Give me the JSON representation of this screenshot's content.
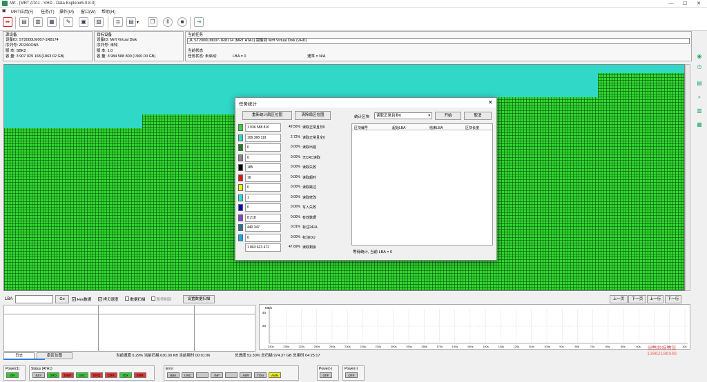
{
  "window": {
    "title": "Mrt - [MRT ATA1 - VHD - Data Explorer6.0.8.3]"
  },
  "menu": [
    "MRT应用(F)",
    "任务(T)",
    "操作(M)",
    "窗口(W)",
    "帮助(H)"
  ],
  "source": {
    "label": "源设备",
    "id": "设备ID: ST2000LM007-1R8174",
    "serial": "序列号: ZDZ60ON5",
    "version": "版    本: SBK2",
    "capacity": "容    量: 3 907 029 168 (1863.02 GB)"
  },
  "target": {
    "label": "目标设备",
    "id": "设备ID: Mrft Virtual Disk",
    "serial": "序列号: 未知",
    "version": "版    本: 1.0",
    "capacity": "容    量: 3 984 588 800 (1900.00 GB)"
  },
  "task": {
    "label": "当前任务",
    "desc": "从 ST2000LM007-1R8174 (MRT ATA1) 镜像到 Mrft Virtual Disk (VHD)",
    "state_label": "当前状态",
    "state": "任务状态: 未启动",
    "lba": "LBA = 0",
    "rate": "速率 = N/A"
  },
  "controls": {
    "lba_label": "LBA",
    "go": "Go",
    "hex": "Hex数据",
    "copy_speed": "拷贝速度",
    "data_scan": "数据扫描",
    "pause_refresh": "暂停刷新",
    "settings": "设置数据扫描",
    "prev_page": "上一页",
    "next_page": "下一页",
    "prev_row": "上一行",
    "next_row": "下一行"
  },
  "chart": {
    "ylabel": "MB/s",
    "ymax": "40",
    "ymid": "20",
    "xticks": [
      "240s",
      "230s",
      "220s",
      "250s",
      "240s",
      "230s",
      "220s",
      "210s",
      "200s",
      "190s",
      "180s",
      "170s",
      "160s",
      "150s",
      "140s",
      "130s",
      "120s",
      "110s",
      "100s",
      "90s",
      "80s",
      "70s",
      "60s",
      "50s",
      "40s",
      "30s",
      "20s",
      "10s"
    ]
  },
  "tabs": {
    "log": "日志",
    "bitmap": "扇区位图"
  },
  "status": {
    "speed": "当前速度 6.29%  当前扫描 630.00 KB  当前用时 00:01:06",
    "total": "总进度 52.30%  总扫描 974.37 GB  总用时 04:25:17"
  },
  "groups": {
    "power1": "Power(1)",
    "status": "Status (ATA1)",
    "error": "Error",
    "power2": "Power(-)",
    "power3": "Power(-)"
  },
  "leds_power1": [
    "ON"
  ],
  "leds_status": [
    "BSY",
    "DRD",
    "DWF",
    "DSC",
    "DRQ",
    "CRR",
    "IDX",
    "ERR"
  ],
  "leds_error": [
    "BBK",
    "UNC",
    "",
    "INF",
    "",
    "ABR",
    "TON",
    "AMN"
  ],
  "leds_power2": [
    "OFF"
  ],
  "leds_power3": [
    "OFF"
  ],
  "colors": {
    "grid_green": "#33d633",
    "grid_cyan": "#30d8c8",
    "accent": "#2a7de1"
  },
  "dialog": {
    "title": "任务统计",
    "rebuild": "重新统计扇区位图",
    "clear": "清除扇区位图",
    "stat_block_label": "统计区块",
    "stat_block_value": "读取正常且非0",
    "start": "开始",
    "cancel": "取消",
    "headers": [
      "区块编号",
      "起始LBA",
      "结束LBA",
      "区块长度"
    ],
    "footer": "等待统计, 当前 LBA = 0",
    "legend": [
      {
        "value": "1 936 588 810",
        "pct": "49.56%",
        "name": "读取正常且非0",
        "color": "#33d633"
      },
      {
        "value": "106 368 119",
        "pct": "2.72%",
        "name": "读取正常且全0",
        "color": "#30d8c8"
      },
      {
        "value": "0",
        "pct": "0.00%",
        "name": "读取出错",
        "color": "#1f7f1f"
      },
      {
        "value": "0",
        "pct": "0.00%",
        "name": "无CRC读取",
        "color": "#888888"
      },
      {
        "value": "185",
        "pct": "0.00%",
        "name": "读取失败",
        "color": "#000000"
      },
      {
        "value": "16",
        "pct": "0.00%",
        "name": "读取超时",
        "color": "#ee1111"
      },
      {
        "value": "0",
        "pct": "0.00%",
        "name": "读取跳过",
        "color": "#f0f000"
      },
      {
        "value": "1",
        "pct": "0.00%",
        "name": "读取修改",
        "color": "#22e0e0"
      },
      {
        "value": "0",
        "pct": "0.00%",
        "name": "写入失败",
        "color": "#0000cc"
      },
      {
        "value": "8 218",
        "pct": "0.00%",
        "name": "有效数据",
        "color": "#8844cc"
      },
      {
        "value": "440 347",
        "pct": "0.01%",
        "name": "标注241A",
        "color": "#227799"
      },
      {
        "value": "0",
        "pct": "0.00%",
        "name": "标注IDU",
        "color": "#11aaee"
      },
      {
        "value": "1 863 623 472",
        "pct": "47.69%",
        "name": "读取剩余",
        "color": ""
      }
    ]
  },
  "watermark": {
    "line1": "盘首数据恢复",
    "line2": "13962186546"
  }
}
